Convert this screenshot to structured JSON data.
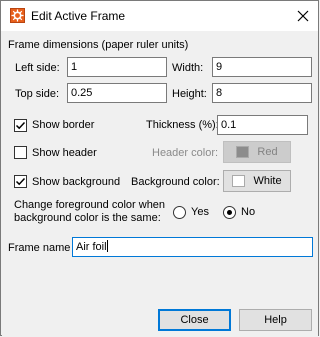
{
  "window": {
    "title": "Edit Active Frame",
    "close_symbol": "✕"
  },
  "dims": {
    "heading": "Frame dimensions (paper ruler units)",
    "left_label": "Left side:",
    "left_value": "1",
    "width_label": "Width:",
    "width_value": "9",
    "top_label": "Top side:",
    "top_value": "0.25",
    "height_label": "Height:",
    "height_value": "8"
  },
  "border": {
    "label": "Show border",
    "checked": true,
    "thickness_label": "Thickness (%):",
    "thickness_value": "0.1"
  },
  "header": {
    "label": "Show header",
    "checked": false,
    "color_label": "Header color:",
    "color_name": "Red",
    "color_hex": "#8c8c8c"
  },
  "background": {
    "label": "Show background",
    "checked": true,
    "color_label": "Background color:",
    "color_name": "White",
    "color_hex": "#ffffff"
  },
  "foreground": {
    "question_line1": "Change foreground color when",
    "question_line2": "background color is the same:",
    "yes_label": "Yes",
    "no_label": "No",
    "selected": "No"
  },
  "frame_name": {
    "label": "Frame name",
    "value": "Air foil"
  },
  "buttons": {
    "close": "Close",
    "help": "Help"
  },
  "colors": {
    "accent": "#0078d7"
  },
  "icons": {
    "app": "frame-settings-icon",
    "close": "close-icon",
    "check": "checkmark-icon"
  }
}
